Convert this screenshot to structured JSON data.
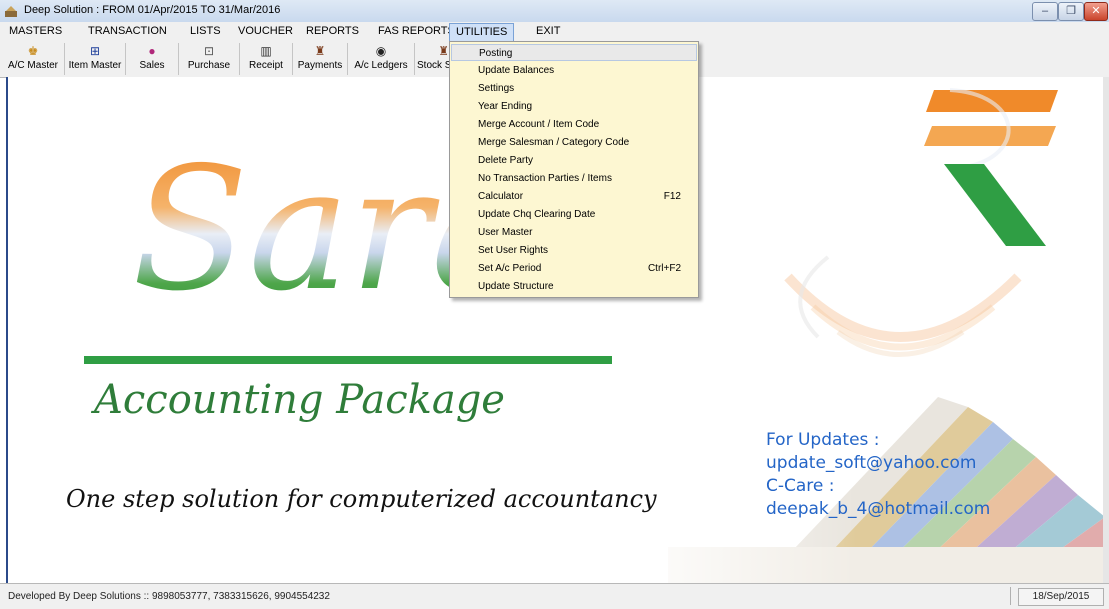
{
  "window": {
    "title": "Deep Solution : FROM 01/Apr/2015 TO 31/Mar/2016",
    "minimize_glyph": "–",
    "restore_glyph": "❐",
    "close_glyph": "✕"
  },
  "menubar": {
    "items": [
      "MASTERS",
      "TRANSACTION",
      "LISTS",
      "VOUCHER",
      "REPORTS",
      "FAS REPORTS",
      "UTILITIES",
      "EXIT"
    ],
    "active": "UTILITIES"
  },
  "toolbar": {
    "buttons": [
      {
        "label": "A/C Master",
        "icon": "accounts-icon"
      },
      {
        "label": "Item Master",
        "icon": "item-icon"
      },
      {
        "label": "Sales",
        "icon": "sales-icon"
      },
      {
        "label": "Purchase",
        "icon": "purchase-icon"
      },
      {
        "label": "Receipt",
        "icon": "receipt-icon"
      },
      {
        "label": "Payments",
        "icon": "payments-icon"
      },
      {
        "label": "A/c Ledgers",
        "icon": "ledger-icon"
      },
      {
        "label": "Stock S",
        "icon": "stock-icon"
      }
    ]
  },
  "utilities_menu": {
    "items": [
      {
        "label": "Posting",
        "shortcut": ""
      },
      {
        "label": "Update Balances",
        "shortcut": ""
      },
      {
        "label": "Settings",
        "shortcut": ""
      },
      {
        "label": "Year Ending",
        "shortcut": ""
      },
      {
        "label": "Merge Account / Item Code",
        "shortcut": ""
      },
      {
        "label": "Merge Salesman / Category Code",
        "shortcut": ""
      },
      {
        "label": "Delete Party",
        "shortcut": ""
      },
      {
        "label": "No Transaction Parties / Items",
        "shortcut": ""
      },
      {
        "label": "Calculator",
        "shortcut": "F12"
      },
      {
        "label": "Update Chq Clearing Date",
        "shortcut": ""
      },
      {
        "label": "User Master",
        "shortcut": ""
      },
      {
        "label": "Set User Rights",
        "shortcut": ""
      },
      {
        "label": "Set A/c Period",
        "shortcut": "Ctrl+F2"
      },
      {
        "label": "Update Structure",
        "shortcut": ""
      }
    ],
    "highlighted": "Posting"
  },
  "splash": {
    "brand": "Sarai",
    "product": "Accounting Package",
    "tagline": "One step solution for computerized accountancy",
    "contact_lines": [
      "For Updates :",
      "update_soft@yahoo.com",
      "C-Care :",
      "deepak_b_4@hotmail.com"
    ]
  },
  "statusbar": {
    "text": "Developed By Deep Solutions  ::  9898053777, 7383315626, 9904554232",
    "date": "18/Sep/2015"
  },
  "colors": {
    "accent_blue": "#2465c7",
    "saffron": "#f08a2a",
    "green": "#2f9e44",
    "menu_bg": "#fdf7d2"
  }
}
